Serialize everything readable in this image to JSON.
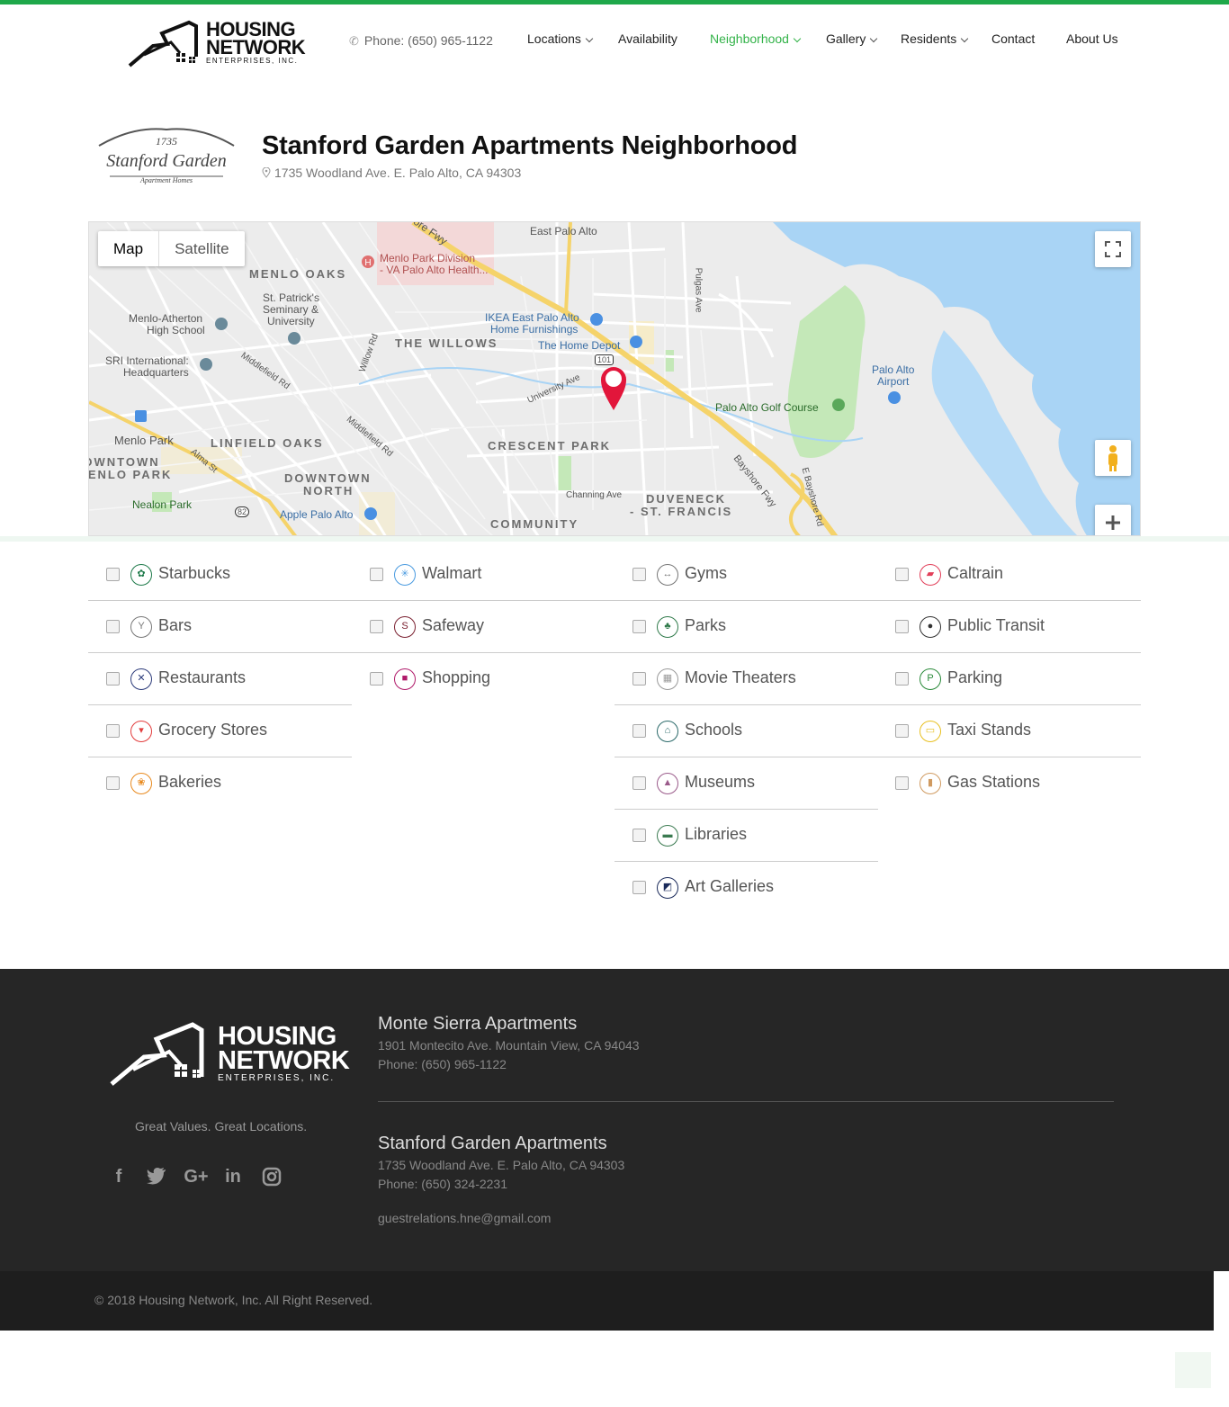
{
  "header": {
    "brand": {
      "line1": "HOUSING",
      "line2": "NETWORK",
      "sub": "ENTERPRISES, INC."
    },
    "phone": "Phone: (650) 965-1122",
    "nav": [
      {
        "label": "Locations",
        "dropdown": true,
        "active": false
      },
      {
        "label": "Availability",
        "dropdown": false,
        "active": false
      },
      {
        "label": "Neighborhood",
        "dropdown": true,
        "active": true
      },
      {
        "label": "Gallery",
        "dropdown": true,
        "active": false
      },
      {
        "label": "Residents",
        "dropdown": true,
        "active": false
      },
      {
        "label": "Contact",
        "dropdown": false,
        "active": false
      },
      {
        "label": "About Us",
        "dropdown": false,
        "active": false
      }
    ]
  },
  "property": {
    "logo": {
      "number": "1735",
      "name": "Stanford Garden",
      "sub": "Apartment Homes"
    },
    "title": "Stanford Garden Apartments Neighborhood",
    "address": "1735 Woodland Ave. E. Palo Alto, CA 94303"
  },
  "map": {
    "toggle": {
      "map": "Map",
      "satellite": "Satellite"
    },
    "labels": {
      "east_palo_alto": "East Palo Alto",
      "menlo_oaks": "MENLO OAKS",
      "menlo_park_division_1": "Menlo Park Division",
      "menlo_park_division_2": "- VA Palo Alto Health...",
      "st_patricks_1": "St. Patrick's",
      "st_patricks_2": "Seminary &",
      "st_patricks_3": "University",
      "menlo_atherton_1": "Menlo-Atherton",
      "menlo_atherton_2": "High School",
      "sri_1": "SRI International:",
      "sri_2": "Headquarters",
      "ikea_1": "IKEA East Palo Alto",
      "ikea_2": "Home Furnishings",
      "home_depot": "The Home Depot",
      "the_willows": "THE WILLOWS",
      "pulgas_ave": "Pulgas Ave",
      "willow_rd": "Willow Rd",
      "middlefield_rd_1": "Middlefield Rd",
      "middlefield_rd_2": "Middlefield Rd",
      "university_ave": "University Ave",
      "palo_alto_airport_1": "Palo Alto",
      "palo_alto_airport_2": "Airport",
      "palo_alto_golf": "Palo Alto Golf Course",
      "menlo_park": "Menlo Park",
      "linfield_oaks": "LINFIELD OAKS",
      "crescent_park": "CRESCENT PARK",
      "alma_st": "Alma St",
      "downtown_menlo_1": "DOWNTOWN",
      "downtown_menlo_2": "MENLO PARK",
      "downtown_north_1": "DOWNTOWN",
      "downtown_north_2": "NORTH",
      "bayshore_fwy": "Bayshore Fwy",
      "channing_ave": "Channing Ave",
      "duveneck_1": "DUVENECK",
      "duveneck_2": "- ST. FRANCIS",
      "nealon_park": "Nealon Park",
      "apple_palo_alto": "Apple Palo Alto",
      "community_center": "COMMUNITY",
      "e_bayshore_rd": "E Bayshore Rd",
      "hwy_101": "101",
      "hwy_82": "82",
      "bayshore_top": "ore Fwy"
    }
  },
  "categories": {
    "col1": [
      {
        "label": "Starbucks",
        "color": "#1e7a4a",
        "icon": "starbucks-icon",
        "glyph": "✿"
      },
      {
        "label": "Bars",
        "color": "#777777",
        "icon": "cocktail-icon",
        "glyph": "Y"
      },
      {
        "label": "Restaurants",
        "color": "#2b3a7a",
        "icon": "utensils-icon",
        "glyph": "✕"
      },
      {
        "label": "Grocery Stores",
        "color": "#e23b3b",
        "icon": "cart-icon",
        "glyph": "▾"
      },
      {
        "label": "Bakeries",
        "color": "#e8891d",
        "icon": "bakery-icon",
        "glyph": "❀"
      }
    ],
    "col2": [
      {
        "label": "Walmart",
        "color": "#4a9be0",
        "icon": "walmart-icon",
        "glyph": "✳"
      },
      {
        "label": "Safeway",
        "color": "#7a2030",
        "icon": "safeway-icon",
        "glyph": "S"
      },
      {
        "label": "Shopping",
        "color": "#b01a6a",
        "icon": "shopping-bag-icon",
        "glyph": "■"
      }
    ],
    "col3": [
      {
        "label": "Gyms",
        "color": "#777777",
        "icon": "dumbbell-icon",
        "glyph": "↔"
      },
      {
        "label": "Parks",
        "color": "#2f7a4a",
        "icon": "tree-icon",
        "glyph": "♣"
      },
      {
        "label": "Movie Theaters",
        "color": "#999999",
        "icon": "film-icon",
        "glyph": "▦"
      },
      {
        "label": "Schools",
        "color": "#2b6a6a",
        "icon": "school-icon",
        "glyph": "⌂"
      },
      {
        "label": "Museums",
        "color": "#9a5a8a",
        "icon": "museum-icon",
        "glyph": "▲"
      },
      {
        "label": "Libraries",
        "color": "#3a7a50",
        "icon": "book-icon",
        "glyph": "▬"
      },
      {
        "label": "Art Galleries",
        "color": "#1a2a5a",
        "icon": "painting-icon",
        "glyph": "◩"
      }
    ],
    "col4": [
      {
        "label": "Caltrain",
        "color": "#e2405a",
        "icon": "train-icon",
        "glyph": "▰"
      },
      {
        "label": "Public Transit",
        "color": "#333333",
        "icon": "bus-icon",
        "glyph": "●"
      },
      {
        "label": "Parking",
        "color": "#2a8a3a",
        "icon": "parking-icon",
        "glyph": "P"
      },
      {
        "label": "Taxi Stands",
        "color": "#e8c020",
        "icon": "taxi-icon",
        "glyph": "▭"
      },
      {
        "label": "Gas Stations",
        "color": "#d09a60",
        "icon": "gas-pump-icon",
        "glyph": "▮"
      }
    ]
  },
  "footer": {
    "brand": {
      "line1": "HOUSING",
      "line2": "NETWORK",
      "sub": "ENTERPRISES, INC."
    },
    "tagline": "Great Values. Great Locations.",
    "social": [
      {
        "glyph": "f",
        "icon": "facebook-icon"
      },
      {
        "glyph": "🐦",
        "icon": "twitter-icon"
      },
      {
        "glyph": "G+",
        "icon": "google-plus-icon"
      },
      {
        "glyph": "in",
        "icon": "linkedin-icon"
      },
      {
        "glyph": "◎",
        "icon": "instagram-icon"
      }
    ],
    "locations": [
      {
        "name": "Monte Sierra Apartments",
        "address": "1901 Montecito Ave. Mountain View, CA 94043",
        "phone": "Phone: (650) 965-1122"
      },
      {
        "name": "Stanford Garden Apartments",
        "address": "1735 Woodland Ave. E. Palo Alto, CA 94303",
        "phone": "Phone: (650) 324-2231"
      }
    ],
    "email": "guestrelations.hne@gmail.com",
    "copyright": "© 2018 Housing Network, Inc. All Right Reserved."
  },
  "colors": {
    "accent": "#1fa84a",
    "nav_active": "#34b34a",
    "footer_bg": "#262626",
    "marker": "#e2163b",
    "water": "#a9d4f5",
    "park": "#c4e8b8"
  }
}
